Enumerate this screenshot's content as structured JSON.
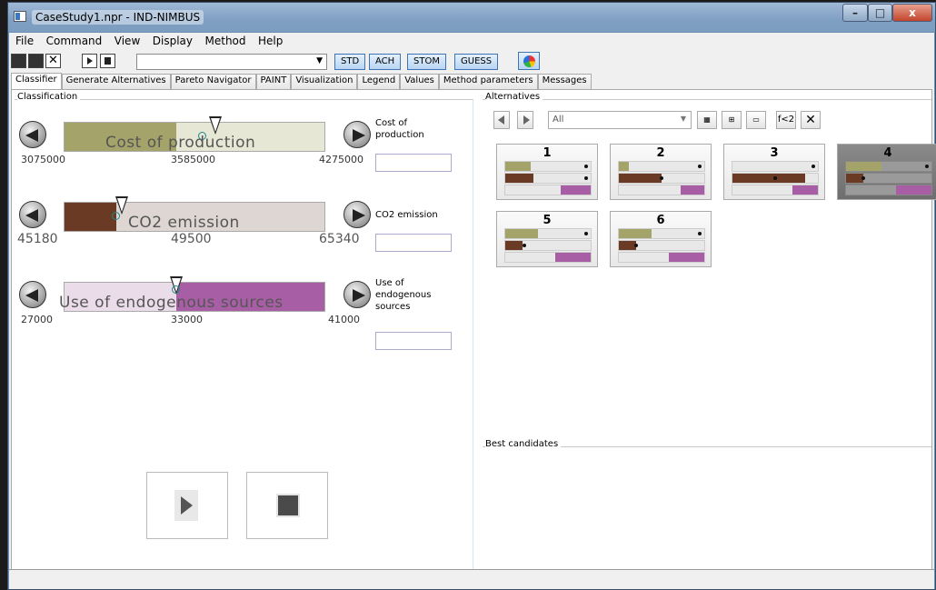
{
  "window": {
    "title": "CaseStudy1.npr - IND-NIMBUS",
    "min": "–",
    "max": "□",
    "close": "x"
  },
  "menu": [
    "File",
    "Command",
    "View",
    "Display",
    "Method",
    "Help"
  ],
  "toolbar": {
    "method_select": "",
    "methods": [
      "STD",
      "ACH",
      "STOM",
      "GUESS"
    ]
  },
  "tabs": [
    "Classifier",
    "Generate Alternatives",
    "Pareto Navigator",
    "PAINT",
    "Visualization",
    "Legend",
    "Values",
    "Method parameters",
    "Messages"
  ],
  "active_tab": "Classifier",
  "classification": {
    "title": "Classification",
    "objectives": [
      {
        "label": "Cost of production",
        "name_lines": [
          "Cost of",
          "production"
        ],
        "min": "3075000",
        "mid": "3585000",
        "max": "4275000",
        "level": 0.43,
        "ref": 0.58,
        "current": 0.53,
        "color": "#a4a36a",
        "rest": "#e7e7d5",
        "ticks_large": false,
        "input": ""
      },
      {
        "label": "CO2 emission",
        "name_lines": [
          "CO2 emission"
        ],
        "min": "45180",
        "mid": "49500",
        "max": "65340",
        "level": 0.2,
        "ref": 0.22,
        "current": 0.2,
        "color": "#6b3a24",
        "rest": "#ddd6d2",
        "ticks_large": true,
        "input": ""
      },
      {
        "label": "Use of endogenous sources",
        "name_lines": [
          "Use of",
          "endogenous",
          "sources"
        ],
        "min": "27000",
        "mid": "33000",
        "max": "41000",
        "level": 0.43,
        "ref": 0.43,
        "current": 0.43,
        "color": "#a75ea5",
        "rest": "#eadde9",
        "ticks_large": false,
        "fill_right": true,
        "input": ""
      }
    ]
  },
  "alternatives": {
    "title": "Alternatives",
    "filter": "All",
    "tools": [
      "grid-large",
      "grid-small",
      "list",
      "f<2",
      "✕"
    ],
    "items": [
      {
        "num": "1",
        "bars": [
          [
            0.3,
            0.95
          ],
          [
            0.33,
            0.95
          ],
          [
            0.65,
            1.0
          ]
        ]
      },
      {
        "num": "2",
        "bars": [
          [
            0.12,
            0.95
          ],
          [
            0.5,
            0.5
          ],
          [
            0.72,
            1.0
          ]
        ]
      },
      {
        "num": "3",
        "bars": [
          [
            0,
            0.95
          ],
          [
            0.85,
            0.5
          ],
          [
            0.7,
            1.0
          ]
        ]
      },
      {
        "num": "4",
        "bars": [
          [
            0.42,
            0.95
          ],
          [
            0.2,
            0.2
          ],
          [
            0.58,
            1.0
          ]
        ]
      },
      {
        "num": "5",
        "bars": [
          [
            0.38,
            0.95
          ],
          [
            0.2,
            0.22
          ],
          [
            0.58,
            0.4
          ]
        ]
      },
      {
        "num": "6",
        "bars": [
          [
            0.38,
            0.95
          ],
          [
            0.2,
            0.2
          ],
          [
            0.58,
            0.4
          ]
        ]
      }
    ]
  },
  "best_candidates": {
    "title": "Best candidates"
  }
}
